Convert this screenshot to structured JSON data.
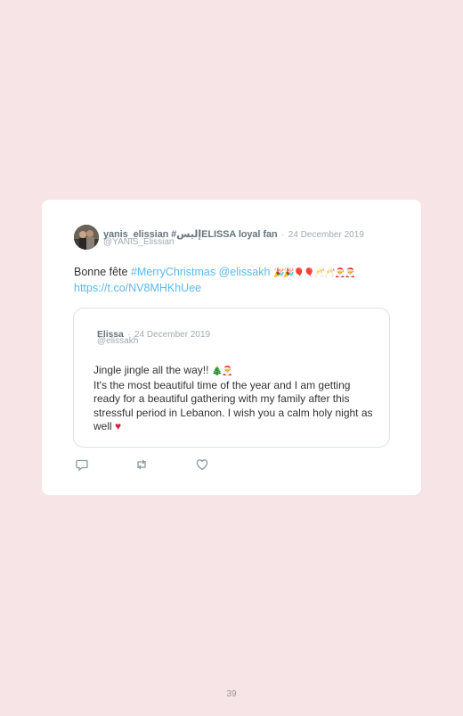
{
  "tweet": {
    "display_name": "yanis_elissian #إليسELISSA loyal fan",
    "separator": "·",
    "date": "24 December 2019",
    "handle": "@YANIS_Elissian",
    "text_prefix": "Bonne fête ",
    "hashtag": "#MerryChristmas",
    "mention": "@elissakh",
    "emojis": "🎉🎉🎈🎈🥂🥂🎅🎅",
    "url": "https://t.co/NV8MHKhUee"
  },
  "quoted": {
    "display_name": "Elissa",
    "separator": "·",
    "date": "24 December 2019",
    "handle": "@elissakh",
    "line1": "Jingle jingle all the way!! ",
    "line1_emojis": "🎄🎅",
    "body": "It's the most beautiful time of the year and I am getting ready for a beautiful gathering with my family after this stressful period in Lebanon. I wish you a calm holy night as well ",
    "heart": "♥"
  },
  "actions": {
    "reply_icon": "reply-icon",
    "retweet_icon": "retweet-icon",
    "like_icon": "heart-icon"
  },
  "footer": {
    "page_number": "39"
  }
}
